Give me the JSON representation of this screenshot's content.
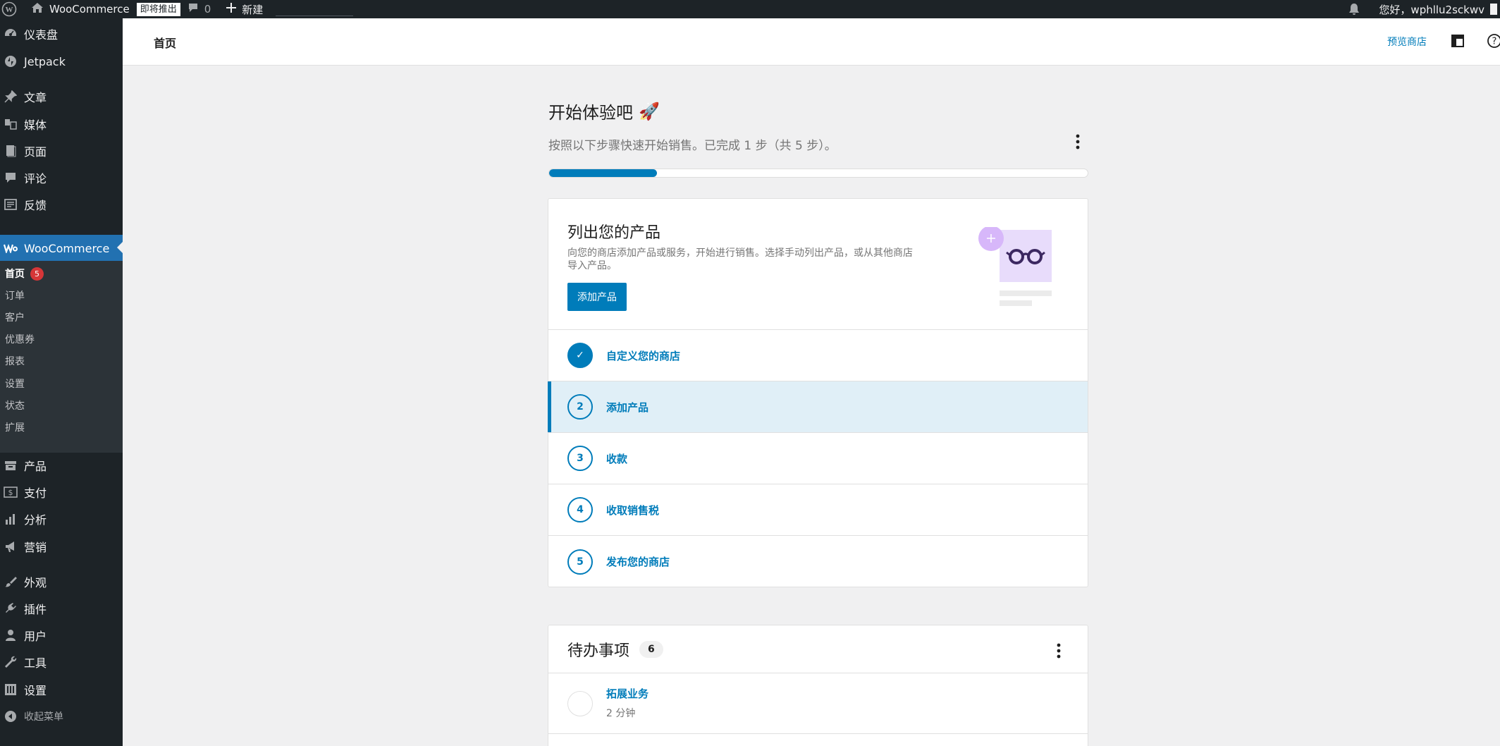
{
  "adminbar": {
    "site_name": "WooCommerce",
    "coming_soon_badge": "即将推出",
    "comments_count": "0",
    "new_label": "新建",
    "greeting": "您好，wphllu2sckwv"
  },
  "sidebar": {
    "items": [
      {
        "label": "仪表盘",
        "icon": "dashboard-icon"
      },
      {
        "label": "Jetpack",
        "icon": "jetpack-icon"
      },
      {
        "label": "文章",
        "icon": "pin-icon"
      },
      {
        "label": "媒体",
        "icon": "media-icon"
      },
      {
        "label": "页面",
        "icon": "pages-icon"
      },
      {
        "label": "评论",
        "icon": "comment-icon"
      },
      {
        "label": "反馈",
        "icon": "feedback-icon"
      },
      {
        "label": "WooCommerce",
        "icon": "woo-icon"
      },
      {
        "label": "产品",
        "icon": "archive-icon"
      },
      {
        "label": "支付",
        "icon": "dollar-icon"
      },
      {
        "label": "分析",
        "icon": "chart-icon"
      },
      {
        "label": "营销",
        "icon": "megaphone-icon"
      },
      {
        "label": "外观",
        "icon": "brush-icon"
      },
      {
        "label": "插件",
        "icon": "plugin-icon"
      },
      {
        "label": "用户",
        "icon": "user-icon"
      },
      {
        "label": "工具",
        "icon": "wrench-icon"
      },
      {
        "label": "设置",
        "icon": "settings-icon"
      },
      {
        "label": "收起菜单",
        "icon": "collapse-icon"
      }
    ],
    "submenu": [
      {
        "label": "首页",
        "badge": "5"
      },
      {
        "label": "订单"
      },
      {
        "label": "客户"
      },
      {
        "label": "优惠券"
      },
      {
        "label": "报表"
      },
      {
        "label": "设置"
      },
      {
        "label": "状态"
      },
      {
        "label": "扩展"
      }
    ]
  },
  "header": {
    "title": "首页",
    "preview_store": "预览商店"
  },
  "task_list": {
    "title": "开始体验吧",
    "title_emoji": "🚀",
    "subtitle": "按照以下步骤快速开始销售。已完成 1 步（共 5 步）。",
    "progress_fraction": 0.2,
    "hero": {
      "title": "列出您的产品",
      "description": "向您的商店添加产品或服务，开始进行销售。选择手动列出产品，或从其他商店导入产品。",
      "button": "添加产品"
    },
    "tasks": [
      {
        "number": "✓",
        "label": "自定义您的商店",
        "state": "done"
      },
      {
        "number": "2",
        "label": "添加产品",
        "state": "current"
      },
      {
        "number": "3",
        "label": "收款",
        "state": "todo"
      },
      {
        "number": "4",
        "label": "收取销售税",
        "state": "todo"
      },
      {
        "number": "5",
        "label": "发布您的商店",
        "state": "todo"
      }
    ]
  },
  "todo": {
    "title": "待办事项",
    "count": "6",
    "items": [
      {
        "label": "拓展业务",
        "time": "2 分钟"
      }
    ]
  },
  "colors": {
    "accent": "#007cba",
    "admin_dark": "#1d2327",
    "wp_active": "#2271b1",
    "badge_red": "#d63638"
  }
}
